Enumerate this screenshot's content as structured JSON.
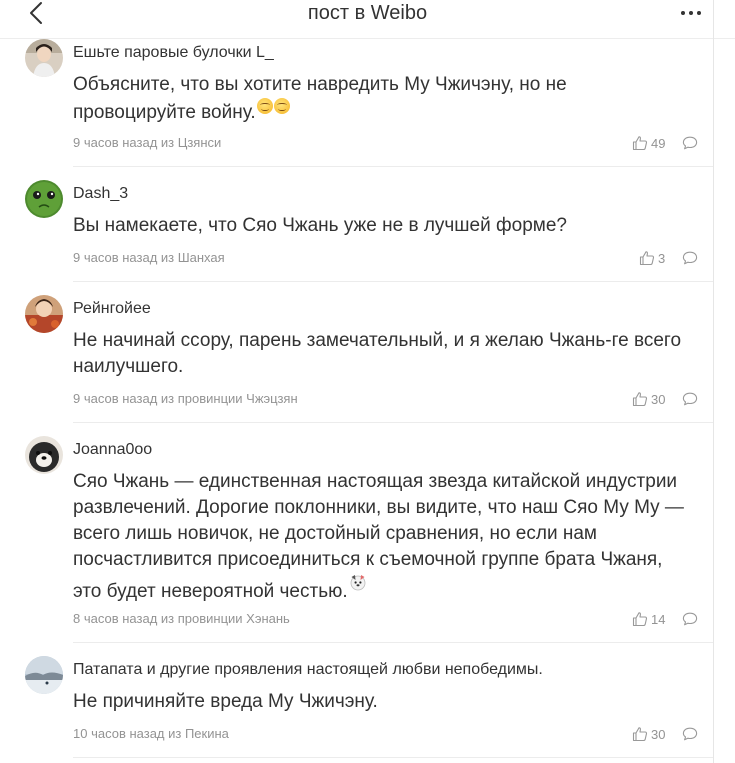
{
  "header": {
    "title": "пост в Weibo",
    "back_icon": "chevron-left-icon",
    "more_icon": "more-dots-icon"
  },
  "colors": {
    "text": "#333333",
    "meta": "#939393",
    "divider": "#ececec"
  },
  "comments": [
    {
      "username": "Ешьте паровые булочки L_",
      "text": "Объясните, что вы хотите навредить Му Чжичэну, но не провоцируйте войну.",
      "emoji": "smiling-face-emoji",
      "meta": "9 часов назад из Цзянси",
      "likes": "49"
    },
    {
      "username": "Dash_3",
      "text": "Вы намекаете, что Сяо Чжань уже не в лучшей форме?",
      "meta": "9 часов назад из Шанхая",
      "likes": "3"
    },
    {
      "username": "Рейнгойее",
      "text": "Не начинай ссору, парень замечательный, и я желаю Чжань-ге всего наилучшего.",
      "meta": "9 часов назад из провинции Чжэцзян",
      "likes": "30"
    },
    {
      "username": "Joanna0oo",
      "text": "Сяо Чжань — единственная настоящая звезда китайской индустрии развлечений. Дорогие поклонники, вы видите, что наш Сяо Му Му — всего лишь новичок, не достойный сравнения, но если нам посчастливится присоединиться к съемочной группе брата Чжаня, это будет невероятной честью.",
      "emoji": "dog-face-emoji",
      "meta": "8 часов назад из провинции Хэнань",
      "likes": "14"
    },
    {
      "username": "Патапата и другие проявления настоящей любви непобедимы.",
      "text": "Не причиняйте вреда Му Чжичэну.",
      "meta": "10 часов назад из Пекина",
      "likes": "30"
    }
  ]
}
